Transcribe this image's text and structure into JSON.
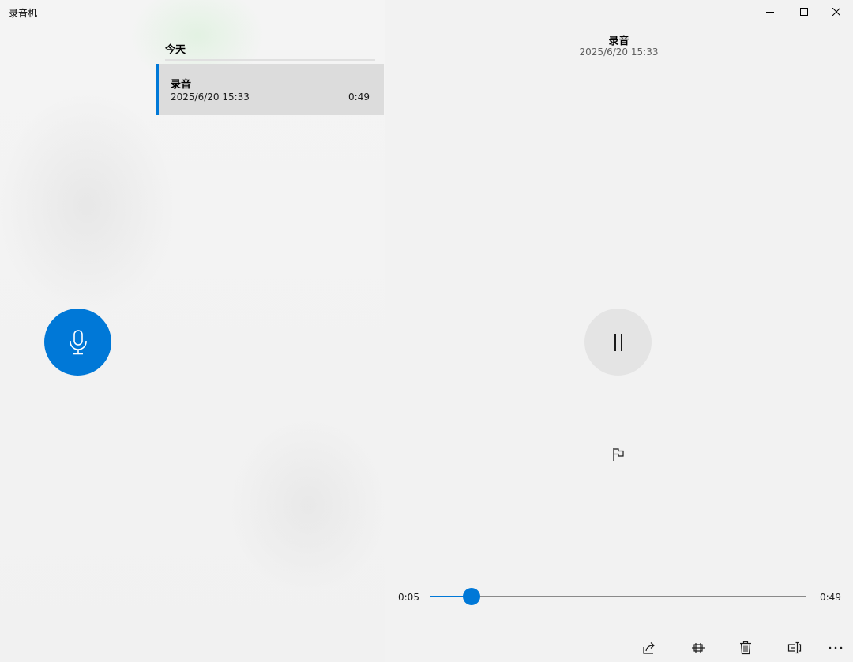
{
  "app": {
    "title": "录音机"
  },
  "window_controls": {
    "minimize": "minimize-icon",
    "maximize": "maximize-icon",
    "close": "close-icon"
  },
  "recordings": {
    "group_label": "今天",
    "items": [
      {
        "name": "录音",
        "date": "2025/6/20 15:33",
        "duration": "0:49",
        "selected": true
      }
    ]
  },
  "record_button": {
    "icon": "microphone-icon"
  },
  "playback": {
    "title": "录音",
    "date": "2025/6/20 15:33",
    "state_icon": "pause-icon",
    "marker_icon": "flag-icon",
    "current_time": "0:05",
    "total_time": "0:49",
    "progress": 0.11
  },
  "toolbar": {
    "items": [
      "share-icon",
      "trim-icon",
      "delete-icon",
      "rename-icon",
      "more-icon"
    ]
  },
  "colors": {
    "accent": "#0078d7",
    "selected_item_bg": "#dcdcdc",
    "pause_bg": "#e4e4e4"
  }
}
